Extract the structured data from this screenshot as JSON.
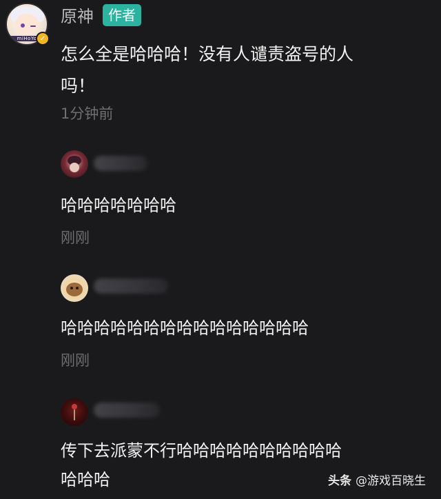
{
  "post": {
    "avatar_brand": "miHoYo",
    "author_name": "原神",
    "author_badge": "作者",
    "text_line1": "怎么全是哈哈哈！没有人谴责盗号的人",
    "text_line2": "吗！",
    "time": "1分钟前"
  },
  "comments": [
    {
      "text": "哈哈哈哈哈哈哈",
      "time": "刚刚"
    },
    {
      "text": "哈哈哈哈哈哈哈哈哈哈哈哈哈哈哈",
      "time": "刚刚"
    },
    {
      "text_line1": "传下去派蒙不行哈哈哈哈哈哈哈哈哈哈",
      "text_line2": "哈哈哈"
    }
  ],
  "watermark": {
    "brand": "头条",
    "account": "@游戏百晓生"
  },
  "icons": {
    "verified": "verified-badge-icon"
  },
  "colors": {
    "background": "#1a1a1c",
    "badge": "#2bb3a0",
    "verified": "#f0b628",
    "muted_text": "#6e6e73"
  }
}
